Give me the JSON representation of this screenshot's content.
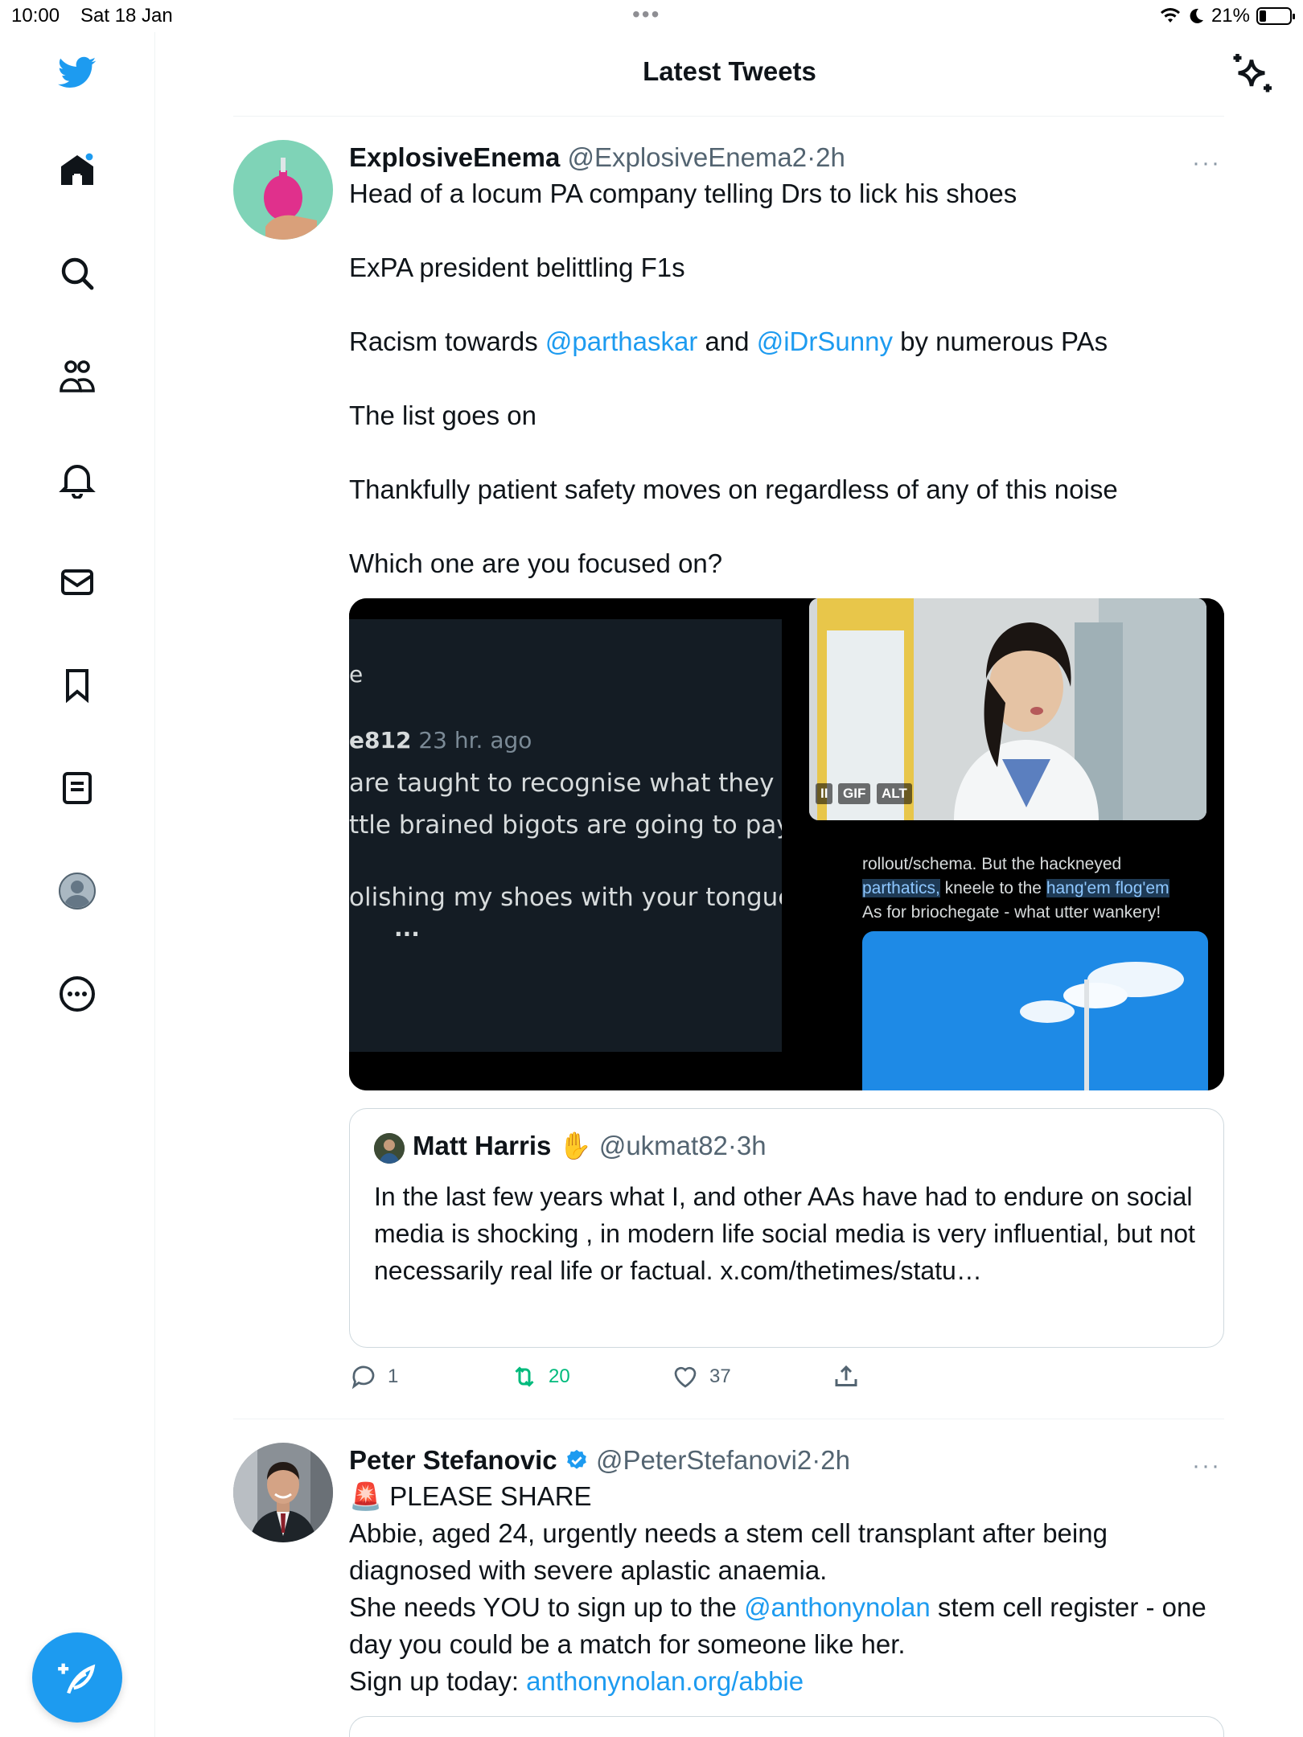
{
  "status_bar": {
    "time": "10:00",
    "date": "Sat 18 Jan",
    "battery": "21%",
    "battery_level": 0.21
  },
  "header": {
    "title": "Latest Tweets"
  },
  "sidebar": {
    "items": [
      "twitter-logo",
      "home",
      "explore",
      "communities",
      "notifications",
      "messages",
      "bookmarks",
      "lists",
      "profile",
      "more"
    ]
  },
  "tweet1": {
    "name": "ExplosiveEnema",
    "handle": "@ExplosiveEnema2",
    "sep": "·",
    "time": "2h",
    "more": "···",
    "line1": "Head of a locum PA company telling Drs to lick his shoes",
    "line2": "ExPA president belittling F1s",
    "line3_pre": "Racism towards ",
    "mention1": "@parthaskar",
    "line3_mid": " and ",
    "mention2": "@iDrSunny",
    "line3_post": " by numerous PAs",
    "line4": "The list goes on",
    "line5": "Thankfully patient safety moves on regardless of any of this noise",
    "line6": "Which one are you focused on?",
    "media1": {
      "line_a": "e",
      "user": "e812",
      "ago": " 23 hr. ago",
      "line_b": "are taught to recognise what they do",
      "line_c": "ttle brained bigots are going to pay.",
      "line_d": "olishing my shoes with your tongue.",
      "dots": "..."
    },
    "media2": {
      "pause": "II",
      "gif": "GIF",
      "alt": "ALT"
    },
    "media3": {
      "l1": "rollout/schema. But the hackneyed",
      "l2a": "parthatics,",
      "l2b": " kneele to the ",
      "l2c": "hang'em flog'em",
      "l3": "As for briochegate - what utter wankery!"
    },
    "quote": {
      "name": "Matt Harris",
      "emoji": "✋",
      "handle": "@ukmat82",
      "sep": "·",
      "time": "3h",
      "text": "In the last few years what I, and other AAs have had to endure on social media is shocking , in modern life social media is very influential, but not necessarily real life or factual. x.com/thetimes/statu…"
    },
    "replies": "1",
    "retweets": "20",
    "likes": "37"
  },
  "tweet2": {
    "name": "Peter Stefanovic",
    "handle": "@PeterStefanovi2",
    "sep": "·",
    "time": "2h",
    "more": "···",
    "siren": "🚨",
    "line1": "PLEASE SHARE",
    "line2": "Abbie, aged 24, urgently needs a stem cell transplant after being diagnosed with severe aplastic anaemia.",
    "line3_pre": "She needs YOU to sign up to the ",
    "mention": "@anthonynolan",
    "line3_post": " stem cell register - one day you could be a match for someone like her.",
    "line4_pre": "Sign up today: ",
    "link": "anthonynolan.org/abbie"
  },
  "colors": {
    "accent": "#1d9bf0",
    "retweet": "#00ba7c",
    "secondary_text": "#536471"
  }
}
